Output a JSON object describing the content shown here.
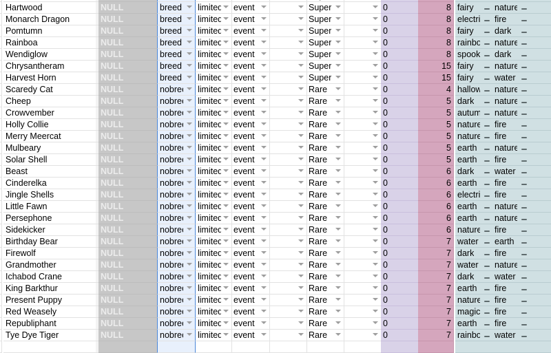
{
  "sheet": {
    "null_label": "NULL",
    "zero_value": "0",
    "rows": [
      {
        "name": "",
        "breed": "",
        "avail": "",
        "source": "",
        "rarity": "Super",
        "zero": "",
        "num": "",
        "type1": "",
        "type2": ""
      },
      {
        "name": "Hartwood",
        "breed": "breed",
        "avail": "limited",
        "source": "event",
        "rarity": "Super",
        "zero": "0",
        "num": "8",
        "type1": "fairy",
        "type2": "nature"
      },
      {
        "name": "Monarch Dragon",
        "breed": "breed",
        "avail": "limited",
        "source": "event",
        "rarity": "Super",
        "zero": "0",
        "num": "8",
        "type1": "electric",
        "type2": "fire"
      },
      {
        "name": "Pomtumn",
        "breed": "breed",
        "avail": "limited",
        "source": "event",
        "rarity": "Super",
        "zero": "0",
        "num": "8",
        "type1": "fairy",
        "type2": "dark"
      },
      {
        "name": "Rainboa",
        "breed": "breed",
        "avail": "limited",
        "source": "event",
        "rarity": "Super",
        "zero": "0",
        "num": "8",
        "type1": "rainbow",
        "type2": "nature"
      },
      {
        "name": "Wendiglow",
        "breed": "breed",
        "avail": "limited",
        "source": "event",
        "rarity": "Super",
        "zero": "0",
        "num": "8",
        "type1": "spooky",
        "type2": "dark"
      },
      {
        "name": "Chrysantheram",
        "breed": "breed",
        "avail": "limited",
        "source": "event",
        "rarity": "Super",
        "zero": "0",
        "num": "15",
        "type1": "fairy",
        "type2": "nature"
      },
      {
        "name": "Harvest Horn",
        "breed": "breed",
        "avail": "limited",
        "source": "event",
        "rarity": "Super",
        "zero": "0",
        "num": "15",
        "type1": "fairy",
        "type2": "water"
      },
      {
        "name": "Scaredy Cat",
        "breed": "nobreed",
        "avail": "limited",
        "source": "event",
        "rarity": "Rare",
        "zero": "0",
        "num": "4",
        "type1": "halloween",
        "type2": "nature"
      },
      {
        "name": "Cheep",
        "breed": "nobreed",
        "avail": "limited",
        "source": "event",
        "rarity": "Rare",
        "zero": "0",
        "num": "5",
        "type1": "dark",
        "type2": "nature"
      },
      {
        "name": "Crowvember",
        "breed": "nobreed",
        "avail": "limited",
        "source": "event",
        "rarity": "Rare",
        "zero": "0",
        "num": "5",
        "type1": "autumn",
        "type2": "nature"
      },
      {
        "name": "Holly Collie",
        "breed": "nobreed",
        "avail": "limited",
        "source": "event",
        "rarity": "Rare",
        "zero": "0",
        "num": "5",
        "type1": "nature",
        "type2": "fire"
      },
      {
        "name": "Merry Meercat",
        "breed": "nobreed",
        "avail": "limited",
        "source": "event",
        "rarity": "Rare",
        "zero": "0",
        "num": "5",
        "type1": "nature",
        "type2": "fire"
      },
      {
        "name": "Mulbeary",
        "breed": "nobreed",
        "avail": "limited",
        "source": "event",
        "rarity": "Rare",
        "zero": "0",
        "num": "5",
        "type1": "earth",
        "type2": "nature"
      },
      {
        "name": "Solar Shell",
        "breed": "nobreed",
        "avail": "limited",
        "source": "event",
        "rarity": "Rare",
        "zero": "0",
        "num": "5",
        "type1": "earth",
        "type2": "fire"
      },
      {
        "name": "Beast",
        "breed": "nobreed",
        "avail": "limited",
        "source": "event",
        "rarity": "Rare",
        "zero": "0",
        "num": "6",
        "type1": "dark",
        "type2": "water"
      },
      {
        "name": "Cinderelka",
        "breed": "nobreed",
        "avail": "limited",
        "source": "event",
        "rarity": "Rare",
        "zero": "0",
        "num": "6",
        "type1": "earth",
        "type2": "fire"
      },
      {
        "name": "Jingle Shells",
        "breed": "nobreed",
        "avail": "limited",
        "source": "event",
        "rarity": "Rare",
        "zero": "0",
        "num": "6",
        "type1": "electric",
        "type2": "fire"
      },
      {
        "name": "Little Fawn",
        "breed": "nobreed",
        "avail": "limited",
        "source": "event",
        "rarity": "Rare",
        "zero": "0",
        "num": "6",
        "type1": "earth",
        "type2": "nature"
      },
      {
        "name": "Persephone",
        "breed": "nobreed",
        "avail": "limited",
        "source": "event",
        "rarity": "Rare",
        "zero": "0",
        "num": "6",
        "type1": "earth",
        "type2": "nature"
      },
      {
        "name": "Sidekicker",
        "breed": "nobreed",
        "avail": "limited",
        "source": "event",
        "rarity": "Rare",
        "zero": "0",
        "num": "6",
        "type1": "nature",
        "type2": "fire"
      },
      {
        "name": "Birthday Bear",
        "breed": "nobreed",
        "avail": "limited",
        "source": "event",
        "rarity": "Rare",
        "zero": "0",
        "num": "7",
        "type1": "water",
        "type2": "earth"
      },
      {
        "name": "Firewolf",
        "breed": "nobreed",
        "avail": "limited",
        "source": "event",
        "rarity": "Rare",
        "zero": "0",
        "num": "7",
        "type1": "dark",
        "type2": "fire"
      },
      {
        "name": "Grandmother",
        "breed": "nobreed",
        "avail": "limited",
        "source": "event",
        "rarity": "Rare",
        "zero": "0",
        "num": "7",
        "type1": "water",
        "type2": "nature"
      },
      {
        "name": "Ichabod Crane",
        "breed": "nobreed",
        "avail": "limited",
        "source": "event",
        "rarity": "Rare",
        "zero": "0",
        "num": "7",
        "type1": "dark",
        "type2": "water"
      },
      {
        "name": "King Barkthur",
        "breed": "nobreed",
        "avail": "limited",
        "source": "event",
        "rarity": "Rare",
        "zero": "0",
        "num": "7",
        "type1": "earth",
        "type2": "fire"
      },
      {
        "name": "Present Puppy",
        "breed": "nobreed",
        "avail": "limited",
        "source": "event",
        "rarity": "Rare",
        "zero": "0",
        "num": "7",
        "type1": "nature",
        "type2": "fire"
      },
      {
        "name": "Red Weasely",
        "breed": "nobreed",
        "avail": "limited",
        "source": "event",
        "rarity": "Rare",
        "zero": "0",
        "num": "7",
        "type1": "magic",
        "type2": "fire"
      },
      {
        "name": "Republiphant",
        "breed": "nobreed",
        "avail": "limited",
        "source": "event",
        "rarity": "Rare",
        "zero": "0",
        "num": "7",
        "type1": "earth",
        "type2": "fire"
      },
      {
        "name": "Tye Dye Tiger",
        "breed": "nobreed",
        "avail": "limited",
        "source": "event",
        "rarity": "Rare",
        "zero": "0",
        "num": "7",
        "type1": "rainbow",
        "type2": "water"
      },
      {
        "name": "",
        "breed": "",
        "avail": "",
        "source": "",
        "rarity": "",
        "zero": "",
        "num": "",
        "type1": "",
        "type2": ""
      }
    ]
  },
  "colors": {
    "null_col": "#c7c7c7",
    "breed_col": "#e8f0fc",
    "selection_border": "#4a86d8",
    "zero_col": "#d9d2e8",
    "num_col": "#d5a6bd",
    "type_col": "#d0e0e3"
  }
}
